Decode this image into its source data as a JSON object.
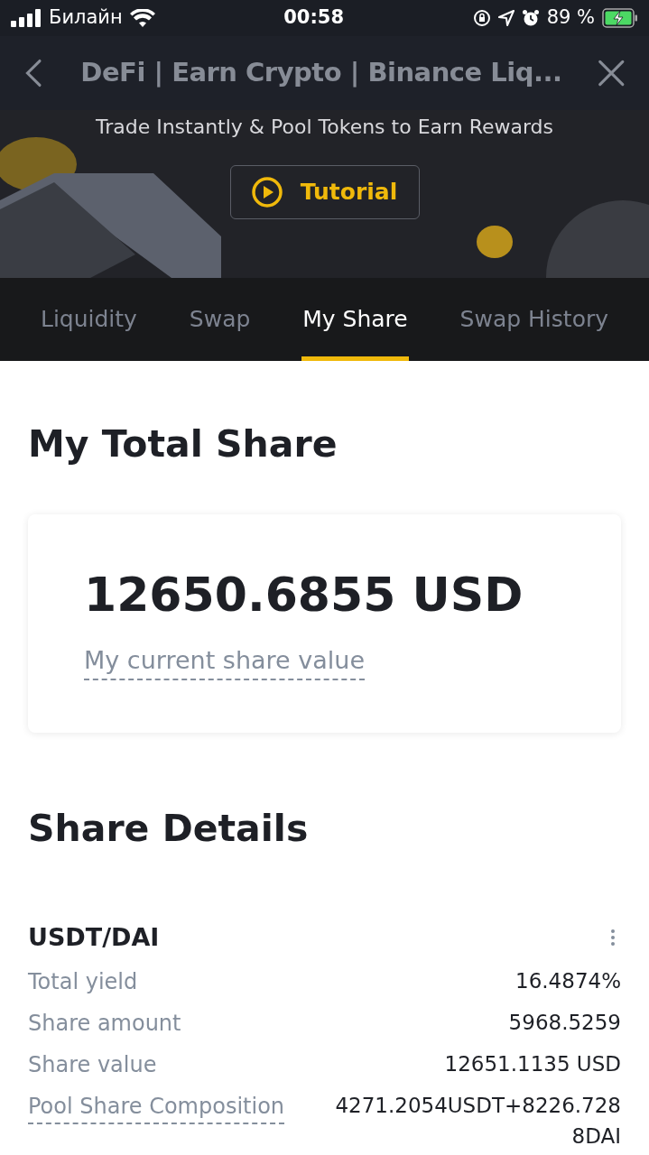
{
  "status_bar": {
    "carrier": "Билайн",
    "time": "00:58",
    "battery": "89 %"
  },
  "nav": {
    "title": "DeFi | Earn Crypto | Binance Liq..."
  },
  "hero": {
    "subtitle": "Trade Instantly & Pool Tokens to Earn Rewards",
    "button": "Tutorial"
  },
  "tabs": [
    {
      "label": "Liquidity",
      "selected": false
    },
    {
      "label": "Swap",
      "selected": false
    },
    {
      "label": "My Share",
      "selected": true
    },
    {
      "label": "Swap History",
      "selected": false
    }
  ],
  "total": {
    "heading": "My Total Share",
    "value": "12650.6855 USD",
    "caption": "My current share value"
  },
  "details": {
    "heading": "Share Details",
    "pair": "USDT/DAI",
    "rows": [
      {
        "label": "Total yield",
        "value": "16.4874%",
        "underlined": false
      },
      {
        "label": "Share amount",
        "value": "5968.5259",
        "underlined": false
      },
      {
        "label": "Share value",
        "value": "12651.1135 USD",
        "underlined": false
      },
      {
        "label": "Pool Share Composition",
        "value": "4271.2054USDT+8226.7288DAI",
        "underlined": true
      }
    ]
  }
}
